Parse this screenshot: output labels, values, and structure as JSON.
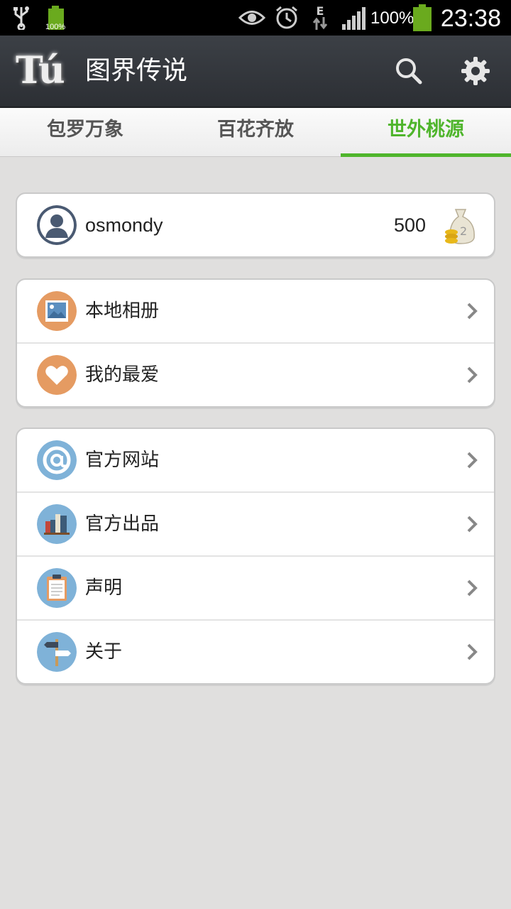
{
  "status_bar": {
    "battery_small_label": "100%",
    "battery_percent": "100%",
    "time": "23:38",
    "network_type": "E"
  },
  "action_bar": {
    "logo_text": "Tú",
    "title": "图界传说",
    "search_icon": "search-icon",
    "settings_icon": "gear-icon"
  },
  "tabs": [
    {
      "label": "包罗万象",
      "active": false
    },
    {
      "label": "百花齐放",
      "active": false
    },
    {
      "label": "世外桃源",
      "active": true
    }
  ],
  "accent_color": "#4fb52c",
  "profile": {
    "username": "osmondy",
    "coins": "500",
    "avatar_icon": "user-avatar-icon",
    "coin_icon": "money-bag-icon"
  },
  "group1": [
    {
      "label": "本地相册",
      "icon": "photo-icon"
    },
    {
      "label": "我的最爱",
      "icon": "heart-icon"
    }
  ],
  "group2": [
    {
      "label": "官方网站",
      "icon": "at-sign-icon"
    },
    {
      "label": "官方出品",
      "icon": "books-icon"
    },
    {
      "label": "声明",
      "icon": "clipboard-icon"
    },
    {
      "label": "关于",
      "icon": "signpost-icon"
    }
  ]
}
